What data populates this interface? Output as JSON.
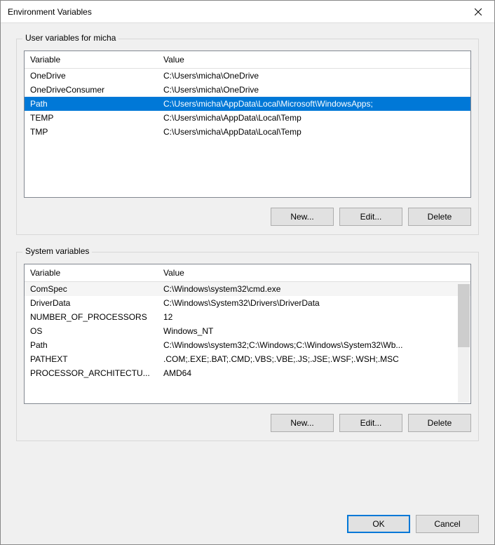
{
  "window": {
    "title": "Environment Variables"
  },
  "user_section": {
    "label": "User variables for micha",
    "columns": {
      "variable": "Variable",
      "value": "Value"
    },
    "rows": [
      {
        "variable": "OneDrive",
        "value": "C:\\Users\\micha\\OneDrive",
        "selected": false
      },
      {
        "variable": "OneDriveConsumer",
        "value": "C:\\Users\\micha\\OneDrive",
        "selected": false
      },
      {
        "variable": "Path",
        "value": "C:\\Users\\micha\\AppData\\Local\\Microsoft\\WindowsApps;",
        "selected": true
      },
      {
        "variable": "TEMP",
        "value": "C:\\Users\\micha\\AppData\\Local\\Temp",
        "selected": false
      },
      {
        "variable": "TMP",
        "value": "C:\\Users\\micha\\AppData\\Local\\Temp",
        "selected": false
      }
    ],
    "buttons": {
      "new": "New...",
      "edit": "Edit...",
      "delete": "Delete"
    }
  },
  "system_section": {
    "label": "System variables",
    "columns": {
      "variable": "Variable",
      "value": "Value"
    },
    "rows": [
      {
        "variable": "ComSpec",
        "value": "C:\\Windows\\system32\\cmd.exe"
      },
      {
        "variable": "DriverData",
        "value": "C:\\Windows\\System32\\Drivers\\DriverData"
      },
      {
        "variable": "NUMBER_OF_PROCESSORS",
        "value": "12"
      },
      {
        "variable": "OS",
        "value": "Windows_NT"
      },
      {
        "variable": "Path",
        "value": "C:\\Windows\\system32;C:\\Windows;C:\\Windows\\System32\\Wb..."
      },
      {
        "variable": "PATHEXT",
        "value": ".COM;.EXE;.BAT;.CMD;.VBS;.VBE;.JS;.JSE;.WSF;.WSH;.MSC"
      },
      {
        "variable": "PROCESSOR_ARCHITECTU...",
        "value": "AMD64"
      }
    ],
    "buttons": {
      "new": "New...",
      "edit": "Edit...",
      "delete": "Delete"
    }
  },
  "dialog_buttons": {
    "ok": "OK",
    "cancel": "Cancel"
  }
}
